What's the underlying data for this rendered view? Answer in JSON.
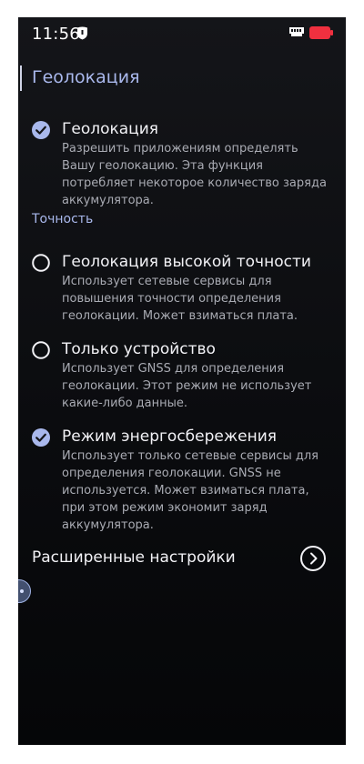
{
  "status_bar": {
    "time": "11:56",
    "icons": [
      "shield-icon",
      "sim-icon",
      "battery-icon"
    ],
    "battery_color": "#f0303f"
  },
  "header": {
    "title": "Геолокация"
  },
  "location_toggle": {
    "title": "Геолокация",
    "description": "Разрешить приложениям определять Вашу геолокацию. Эта функция потребляет некоторое количество заряда аккумулятора.",
    "checked": true
  },
  "accuracy": {
    "section_label": "Точность",
    "options": [
      {
        "title": "Геолокация высокой точности",
        "description": "Использует сетевые сервисы для повышения точности определения геолокации. Может взиматься плата.",
        "selected": false
      },
      {
        "title": "Только устройство",
        "description": "Использует GNSS для определения геолокации. Этот режим не использует какие-либо данные.",
        "selected": false
      },
      {
        "title": "Режим энергосбережения",
        "description": "Использует только сетевые сервисы для определения геолокации. GNSS не используется. Может взиматься плата, при этом режим экономит заряд аккумулятора.",
        "selected": true
      }
    ]
  },
  "advanced": {
    "label": "Расширенные настройки"
  },
  "colors": {
    "accent": "#a9b8ec",
    "check_fill": "#a9b8ec",
    "background": "#0b0c0f"
  }
}
